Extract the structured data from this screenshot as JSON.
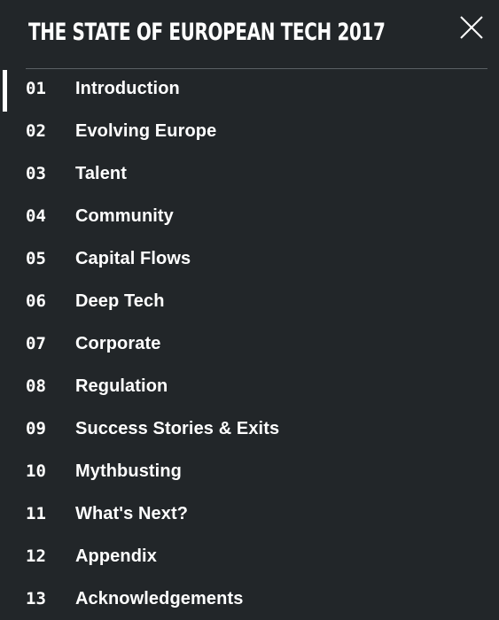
{
  "header": {
    "title": "THE STATE OF EUROPEAN TECH 2017",
    "close_icon": "close-icon"
  },
  "nav": {
    "active_index": 0,
    "items": [
      {
        "num": "01",
        "label": "Introduction"
      },
      {
        "num": "02",
        "label": "Evolving Europe"
      },
      {
        "num": "03",
        "label": "Talent"
      },
      {
        "num": "04",
        "label": "Community"
      },
      {
        "num": "05",
        "label": "Capital Flows"
      },
      {
        "num": "06",
        "label": "Deep Tech"
      },
      {
        "num": "07",
        "label": "Corporate"
      },
      {
        "num": "08",
        "label": "Regulation"
      },
      {
        "num": "09",
        "label": "Success Stories & Exits"
      },
      {
        "num": "10",
        "label": "Mythbusting"
      },
      {
        "num": "11",
        "label": "What's Next?"
      },
      {
        "num": "12",
        "label": "Appendix"
      },
      {
        "num": "13",
        "label": "Acknowledgements"
      }
    ]
  },
  "colors": {
    "background": "#222629",
    "text": "#ffffff",
    "divider": "#5b6064",
    "active_marker": "#ffffff"
  }
}
